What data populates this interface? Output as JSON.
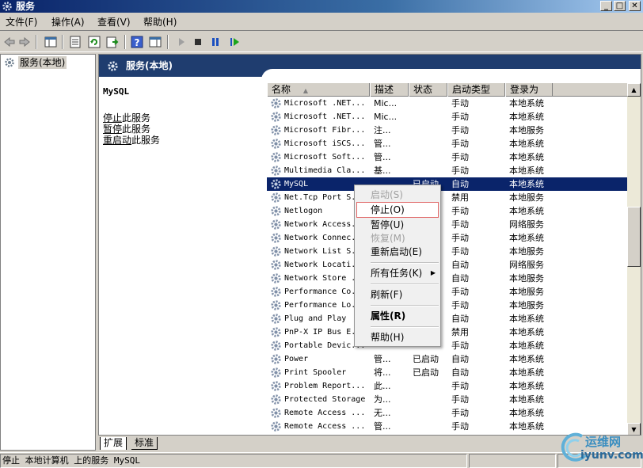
{
  "window": {
    "title": "服务",
    "min_label": "_",
    "max_label": "□",
    "close_label": "✕"
  },
  "menu": [
    {
      "label": "文件(F)"
    },
    {
      "label": "操作(A)"
    },
    {
      "label": "查看(V)"
    },
    {
      "label": "帮助(H)"
    }
  ],
  "toolbar": {
    "icons": [
      "back-arrow-icon",
      "forward-arrow-icon",
      "console-tree-icon",
      "properties-icon",
      "refresh-icon",
      "export-list-icon",
      "help-icon",
      "show-hide-icon",
      "start-service-icon",
      "stop-service-icon",
      "pause-service-icon",
      "restart-service-icon"
    ]
  },
  "tree": {
    "root_label": "服务(本地)"
  },
  "header": {
    "title": "服务(本地)"
  },
  "detail": {
    "service_name": "MySQL",
    "stop_link": "停止",
    "stop_rest": "此服务",
    "pause_link": "暂停",
    "pause_rest": "此服务",
    "restart_link": "重启动",
    "restart_rest": "此服务"
  },
  "columns": [
    "名称",
    "描述",
    "状态",
    "启动类型",
    "登录为"
  ],
  "sort_indicator": "▲",
  "rows": [
    {
      "name": "Microsoft .NET...",
      "desc": "Mic...",
      "status": "",
      "startup": "手动",
      "logon": "本地系统"
    },
    {
      "name": "Microsoft .NET...",
      "desc": "Mic...",
      "status": "",
      "startup": "手动",
      "logon": "本地系统"
    },
    {
      "name": "Microsoft Fibr...",
      "desc": "注...",
      "status": "",
      "startup": "手动",
      "logon": "本地服务"
    },
    {
      "name": "Microsoft iSCS...",
      "desc": "管...",
      "status": "",
      "startup": "手动",
      "logon": "本地系统"
    },
    {
      "name": "Microsoft Soft...",
      "desc": "管...",
      "status": "",
      "startup": "手动",
      "logon": "本地系统"
    },
    {
      "name": "Multimedia Cla...",
      "desc": "基...",
      "status": "",
      "startup": "手动",
      "logon": "本地系统"
    },
    {
      "name": "MySQL",
      "desc": "",
      "status": "已启动",
      "startup": "自动",
      "logon": "本地系统"
    },
    {
      "name": "Net.Tcp Port S...",
      "desc": "",
      "status": "",
      "startup": "禁用",
      "logon": "本地服务"
    },
    {
      "name": "Netlogon",
      "desc": "",
      "status": "",
      "startup": "手动",
      "logon": "本地系统"
    },
    {
      "name": "Network Access...",
      "desc": "",
      "status": "",
      "startup": "手动",
      "logon": "网络服务"
    },
    {
      "name": "Network Connec...",
      "desc": "",
      "status": "",
      "startup": "手动",
      "logon": "本地系统"
    },
    {
      "name": "Network List S...",
      "desc": "",
      "status": "",
      "startup": "手动",
      "logon": "本地服务"
    },
    {
      "name": "Network Locati...",
      "desc": "",
      "status": "",
      "startup": "自动",
      "logon": "网络服务"
    },
    {
      "name": "Network Store ...",
      "desc": "",
      "status": "",
      "startup": "自动",
      "logon": "本地服务"
    },
    {
      "name": "Performance Co...",
      "desc": "",
      "status": "",
      "startup": "手动",
      "logon": "本地服务"
    },
    {
      "name": "Performance Lo...",
      "desc": "",
      "status": "",
      "startup": "手动",
      "logon": "本地服务"
    },
    {
      "name": "Plug and Play",
      "desc": "",
      "status": "",
      "startup": "自动",
      "logon": "本地系统"
    },
    {
      "name": "PnP-X IP Bus E...",
      "desc": "",
      "status": "",
      "startup": "禁用",
      "logon": "本地系统"
    },
    {
      "name": "Portable Devic...",
      "desc": "",
      "status": "",
      "startup": "手动",
      "logon": "本地系统"
    },
    {
      "name": "Power",
      "desc": "管...",
      "status": "已启动",
      "startup": "自动",
      "logon": "本地系统"
    },
    {
      "name": "Print Spooler",
      "desc": "将...",
      "status": "已启动",
      "startup": "自动",
      "logon": "本地系统"
    },
    {
      "name": "Problem Report...",
      "desc": "此...",
      "status": "",
      "startup": "手动",
      "logon": "本地系统"
    },
    {
      "name": "Protected Storage",
      "desc": "为...",
      "status": "",
      "startup": "手动",
      "logon": "本地系统"
    },
    {
      "name": "Remote Access ...",
      "desc": "无...",
      "status": "",
      "startup": "手动",
      "logon": "本地系统"
    },
    {
      "name": "Remote Access ...",
      "desc": "管...",
      "status": "",
      "startup": "手动",
      "logon": "本地系统"
    }
  ],
  "selected_row": 6,
  "context_menu": {
    "start": "启动(S)",
    "stop": "停止(O)",
    "pause": "暂停(U)",
    "resume": "恢复(M)",
    "restart": "重新启动(E)",
    "all_tasks": "所有任务(K)",
    "submenu_arrow": "▶",
    "refresh": "刷新(F)",
    "properties": "属性(R)",
    "help": "帮助(H)"
  },
  "tabs": {
    "extended": "扩展",
    "standard": "标准"
  },
  "statusbar": {
    "text": "停止 本地计算机 上的服务 MySQL"
  },
  "watermark": {
    "line1": "运维网",
    "line2": "iyunv.com"
  }
}
